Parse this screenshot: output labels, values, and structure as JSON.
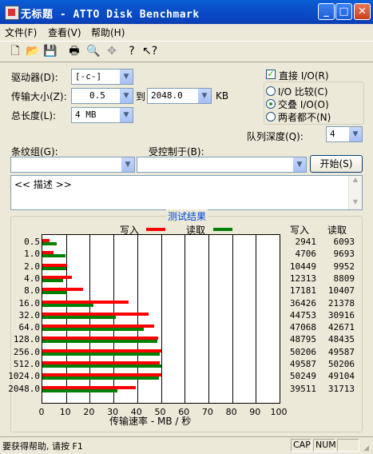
{
  "window": {
    "title": "无标题 - ATTO Disk Benchmark",
    "minimize": "_",
    "maximize": "□",
    "close": "✕"
  },
  "menu": {
    "file": "文件(F)",
    "view": "查看(V)",
    "help": "帮助(H)"
  },
  "toolbar": {
    "icons": [
      "new-icon",
      "open-icon",
      "save-icon",
      "print-icon",
      "print-preview-icon",
      "move-icon",
      "help-icon",
      "context-help-icon"
    ]
  },
  "settings": {
    "drive_label": "驱动器(D):",
    "drive_value": "[-c-]",
    "transfer_label": "传输大小(Z):",
    "transfer_from": "0.5",
    "to_label": "到",
    "transfer_to": "2048.0",
    "unit": "KB",
    "total_label": "总长度(L):",
    "total_value": "4 MB",
    "direct_io": "直接 I/O(R)",
    "radio_compare": "I/O 比较(C)",
    "radio_overlap": "交叠 I/O(O)",
    "radio_neither": "两者都不(N)",
    "queue_label": "队列深度(Q):",
    "queue_value": "4",
    "stripe_label": "条纹组(G):",
    "controlled_label": "受控制于(B):",
    "start_button": "开始(S)",
    "description": "<< 描述 >>"
  },
  "results": {
    "group_title": "测试结果",
    "legend_write": "写入",
    "legend_read": "读取",
    "col_write": "写入",
    "col_read": "读取",
    "colors": {
      "write": "#ff0000",
      "read": "#008000"
    },
    "rows": [
      {
        "size": "0.5",
        "write": "2941",
        "read": "6093"
      },
      {
        "size": "1.0",
        "write": "4706",
        "read": "9693"
      },
      {
        "size": "2.0",
        "write": "10449",
        "read": "9952"
      },
      {
        "size": "4.0",
        "write": "12313",
        "read": "8809"
      },
      {
        "size": "8.0",
        "write": "17181",
        "read": "10407"
      },
      {
        "size": "16.0",
        "write": "36426",
        "read": "21378"
      },
      {
        "size": "32.0",
        "write": "44753",
        "read": "30916"
      },
      {
        "size": "64.0",
        "write": "47068",
        "read": "42671"
      },
      {
        "size": "128.0",
        "write": "48795",
        "read": "48435"
      },
      {
        "size": "256.0",
        "write": "50206",
        "read": "49587"
      },
      {
        "size": "512.0",
        "write": "49587",
        "read": "50206"
      },
      {
        "size": "1024.0",
        "write": "50249",
        "read": "49104"
      },
      {
        "size": "2048.0",
        "write": "39511",
        "read": "31713"
      }
    ],
    "x_ticks": [
      "0",
      "10",
      "20",
      "30",
      "40",
      "50",
      "60",
      "70",
      "80",
      "90",
      "100"
    ],
    "x_label": "传输速率 - MB / 秒"
  },
  "chart_data": {
    "type": "bar",
    "categories": [
      "0.5",
      "1.0",
      "2.0",
      "4.0",
      "8.0",
      "16.0",
      "32.0",
      "64.0",
      "128.0",
      "256.0",
      "512.0",
      "1024.0",
      "2048.0"
    ],
    "series": [
      {
        "name": "写入",
        "values": [
          2.941,
          4.706,
          10.449,
          12.313,
          17.181,
          36.426,
          44.753,
          47.068,
          48.795,
          50.206,
          49.587,
          50.249,
          39.511
        ]
      },
      {
        "name": "读取",
        "values": [
          6.093,
          9.693,
          9.952,
          8.809,
          10.407,
          21.378,
          30.916,
          42.671,
          48.435,
          49.587,
          50.206,
          49.104,
          31.713
        ]
      }
    ],
    "xlabel": "传输速率 - MB / 秒",
    "xlim": [
      0,
      100
    ],
    "orientation": "horizontal"
  },
  "status": {
    "help": "要获得帮助, 请按 F1",
    "cap": "CAP",
    "num": "NUM"
  }
}
